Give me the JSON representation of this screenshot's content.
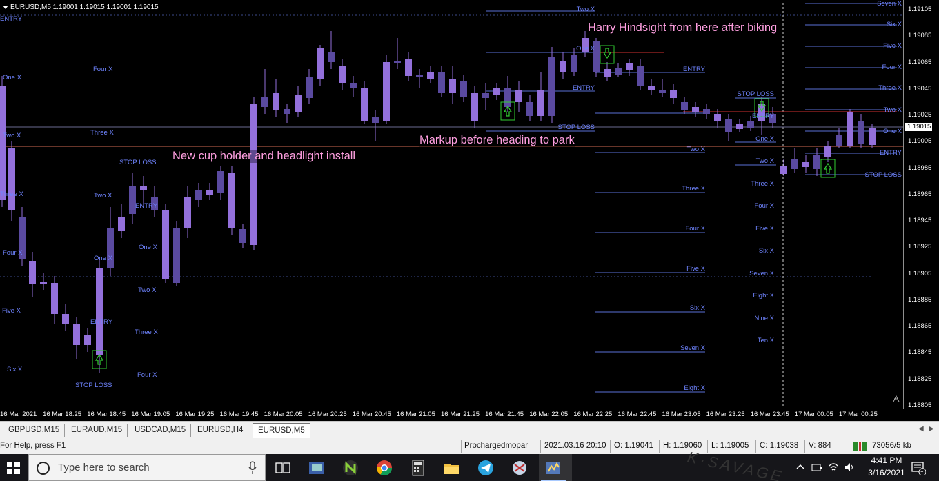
{
  "chart": {
    "symbol_line": "EURUSD,M5  1.19001 1.19015 1.19001 1.19015",
    "current_price": "1.19015",
    "price_ticks": [
      "1.19105",
      "1.19085",
      "1.19065",
      "1.19045",
      "1.19025",
      "1.19005",
      "1.18985",
      "1.18965",
      "1.18945",
      "1.18925",
      "1.18905",
      "1.18885",
      "1.18865",
      "1.18845",
      "1.18825",
      "1.18805"
    ],
    "time_ticks": [
      "16 Mar 2021",
      "16 Mar 18:25",
      "16 Mar 18:45",
      "16 Mar 19:05",
      "16 Mar 19:25",
      "16 Mar 19:45",
      "16 Mar 20:05",
      "16 Mar 20:25",
      "16 Mar 20:45",
      "16 Mar 21:05",
      "16 Mar 21:25",
      "16 Mar 21:45",
      "16 Mar 22:05",
      "16 Mar 22:25",
      "16 Mar 22:45",
      "16 Mar 23:05",
      "16 Mar 23:25",
      "16 Mar 23:45",
      "17 Mar 00:05",
      "17 Mar 00:25"
    ],
    "annotations": {
      "hindsight": "Harry Hindsight from here after biking",
      "markup": "Markup before heading to park",
      "cupholder": "New cup holder and headlight install"
    },
    "level_labels": {
      "entry": "ENTRY",
      "stop_loss": "STOP LOSS",
      "one_x": "One X",
      "two_x": "Two X",
      "three_x": "Three X",
      "four_x": "Four X",
      "five_x": "Five X",
      "six_x": "Six X",
      "seven_x": "Seven X",
      "eight_x": "Eight X",
      "nine_x": "Nine X",
      "ten_x": "Ten X"
    },
    "colors": {
      "candle": "#9370db",
      "level": "#5a6fd6",
      "label": "#6f84ff",
      "annotation": "#ff9fe0",
      "signal": "#32cd32"
    }
  },
  "tabs": [
    {
      "label": "GBPUSD,M15",
      "active": false
    },
    {
      "label": "EURAUD,M15",
      "active": false
    },
    {
      "label": "USDCAD,M15",
      "active": false
    },
    {
      "label": "EURUSD,H4",
      "active": false
    },
    {
      "label": "EURUSD,M5",
      "active": true
    }
  ],
  "status": {
    "help": "For Help, press F1",
    "profile": "Prochargedmopar",
    "datetime": "2021.03.16 20:10",
    "open": "O: 1.19041",
    "high": "H: 1.19060",
    "low": "L: 1.19005",
    "close": "C: 1.19038",
    "volume": "V: 884",
    "traffic": "73056/5 kb"
  },
  "taskbar": {
    "search_placeholder": "Type here to search",
    "time": "4:41 PM",
    "date": "3/16/2021",
    "notification_count": "1",
    "apps": [
      "task-view-icon",
      "network-app-icon",
      "green-n-app-icon",
      "chrome-icon",
      "calculator-icon",
      "file-explorer-icon",
      "telegram-icon",
      "snipping-tool-icon",
      "metatrader-icon"
    ]
  }
}
